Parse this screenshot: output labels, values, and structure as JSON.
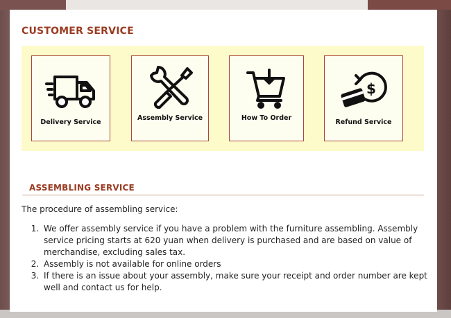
{
  "page": {
    "title": "CUSTOMER SERVICE"
  },
  "services": [
    {
      "label": "Delivery Service",
      "icon": "delivery-truck-icon"
    },
    {
      "label": "Assembly Service",
      "icon": "wrench-screwdriver-icon"
    },
    {
      "label": "How To Order",
      "icon": "shopping-cart-icon"
    },
    {
      "label": "Refund Service",
      "icon": "refund-card-icon"
    }
  ],
  "assembling": {
    "heading": "ASSEMBLING SERVICE",
    "intro": "The procedure of assembling service:",
    "steps": [
      "We offer assembly service if you have a problem with the furniture assembling. Assembly service pricing starts at 620 yuan when delivery is purchased and are based on value of merchandise, excluding sales tax.",
      "Assembly is not available for online orders",
      "If there is an issue about your assembly, make sure your receipt and order number are kept well and contact us for help."
    ]
  },
  "colors": {
    "accent": "#9a3b22",
    "panel": "#fdfbc9",
    "card_border": "#a8463f"
  }
}
